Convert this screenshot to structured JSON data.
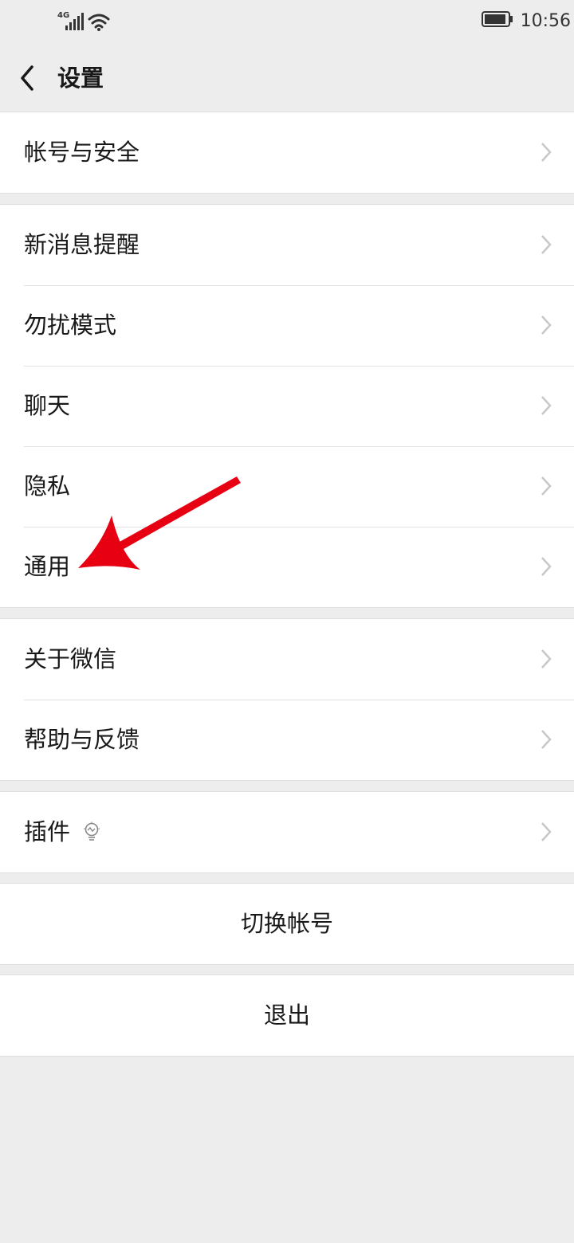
{
  "status_bar": {
    "network": "4G",
    "time": "10:56"
  },
  "nav": {
    "title": "设置"
  },
  "groups": [
    {
      "items": [
        {
          "label": "帐号与安全"
        }
      ]
    },
    {
      "items": [
        {
          "label": "新消息提醒"
        },
        {
          "label": "勿扰模式"
        },
        {
          "label": "聊天"
        },
        {
          "label": "隐私"
        },
        {
          "label": "通用"
        }
      ]
    },
    {
      "items": [
        {
          "label": "关于微信"
        },
        {
          "label": "帮助与反馈"
        }
      ]
    },
    {
      "items": [
        {
          "label": "插件"
        }
      ]
    }
  ],
  "actions": {
    "switch_account": "切换帐号",
    "logout": "退出"
  },
  "colors": {
    "page_background": "#ededed",
    "row_background": "#ffffff",
    "annotation_arrow": "#e60012",
    "chevron": "#c8c8c8"
  }
}
